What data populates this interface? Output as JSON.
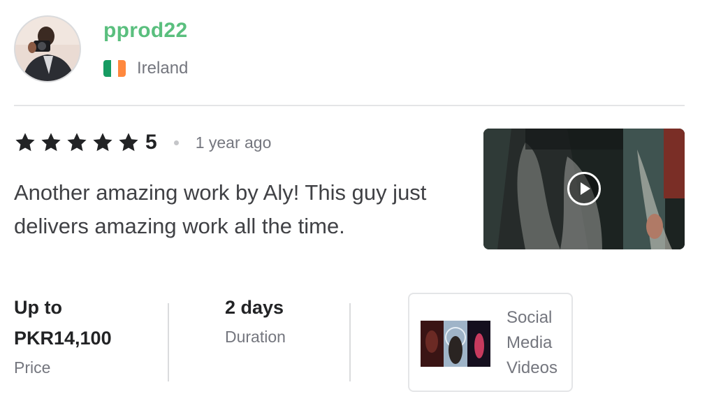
{
  "reviewer": {
    "username": "pprod22",
    "country": "Ireland",
    "flag_colors": [
      "#169b62",
      "#ffffff",
      "#ff883e"
    ]
  },
  "review": {
    "stars": 5,
    "score": "5",
    "time_ago": "1 year ago",
    "text": "Another amazing work by Aly! This guy just delivers amazing work all the time."
  },
  "stats": {
    "price_value_line1": "Up to",
    "price_value_line2": "PKR14,100",
    "price_label": "Price",
    "duration_value": "2 days",
    "duration_label": "Duration"
  },
  "category": {
    "name": "Social Media Videos"
  },
  "media": {
    "icon": "play-icon"
  },
  "colors": {
    "username": "#5abf7e",
    "star": "#222325",
    "text": "#404145",
    "muted": "#74767e",
    "divider": "#e4e5e7"
  }
}
